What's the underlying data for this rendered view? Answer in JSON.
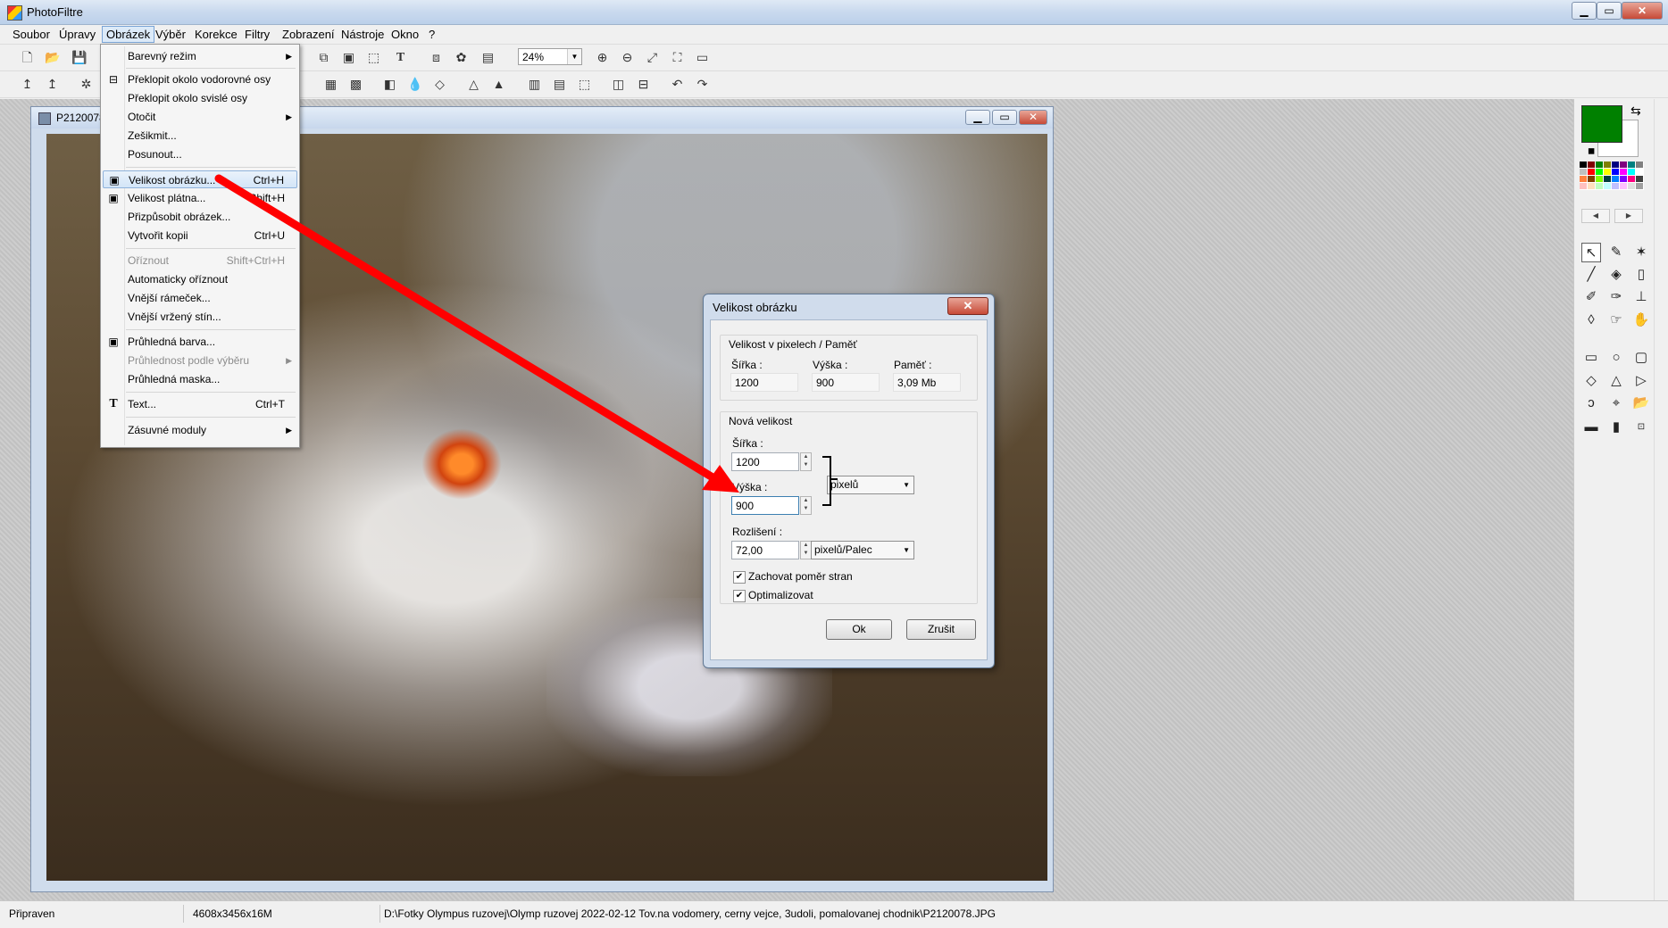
{
  "app": {
    "title": "PhotoFiltre"
  },
  "window_controls": {
    "minimize": "▁",
    "restore": "▭",
    "close": "✕"
  },
  "menubar": [
    "Soubor",
    "Úpravy",
    "Obrázek",
    "Výběr",
    "Korekce",
    "Filtry",
    "Zobrazení",
    "Nástroje",
    "Okno",
    "?"
  ],
  "toolbar": {
    "zoom": "24%"
  },
  "document": {
    "title": "P2120078"
  },
  "image_menu": {
    "items": [
      {
        "label": "Barevný režim",
        "shortcut": "",
        "submenu": true,
        "icon": "",
        "disabled": false
      },
      {
        "label": "Překlopit okolo vodorovné osy",
        "shortcut": "",
        "submenu": false,
        "icon": "flip-horizontal-icon",
        "disabled": false
      },
      {
        "label": "Překlopit okolo svislé osy",
        "shortcut": "",
        "submenu": false,
        "icon": "",
        "disabled": false
      },
      {
        "label": "Otočit",
        "shortcut": "",
        "submenu": true,
        "icon": "",
        "disabled": false
      },
      {
        "label": "Zešikmit...",
        "shortcut": "",
        "submenu": false,
        "icon": "",
        "disabled": false
      },
      {
        "label": "Posunout...",
        "shortcut": "",
        "submenu": false,
        "icon": "",
        "disabled": false
      },
      {
        "label": "Velikost obrázku...",
        "shortcut": "Ctrl+H",
        "submenu": false,
        "icon": "image-size-icon",
        "disabled": false
      },
      {
        "label": "Velikost plátna...",
        "shortcut": "Shift+H",
        "submenu": false,
        "icon": "canvas-size-icon",
        "disabled": false
      },
      {
        "label": "Přizpůsobit obrázek...",
        "shortcut": "",
        "submenu": false,
        "icon": "",
        "disabled": false
      },
      {
        "label": "Vytvořit kopii",
        "shortcut": "Ctrl+U",
        "submenu": false,
        "icon": "",
        "disabled": false
      },
      {
        "label": "Oříznout",
        "shortcut": "Shift+Ctrl+H",
        "submenu": false,
        "icon": "",
        "disabled": true
      },
      {
        "label": "Automaticky oříznout",
        "shortcut": "",
        "submenu": false,
        "icon": "",
        "disabled": false
      },
      {
        "label": "Vnější rámeček...",
        "shortcut": "",
        "submenu": false,
        "icon": "",
        "disabled": false
      },
      {
        "label": "Vnější vržený stín...",
        "shortcut": "",
        "submenu": false,
        "icon": "",
        "disabled": false
      },
      {
        "label": "Průhledná barva...",
        "shortcut": "",
        "submenu": false,
        "icon": "transparent-color-icon",
        "disabled": false
      },
      {
        "label": "Průhlednost podle výběru",
        "shortcut": "",
        "submenu": true,
        "icon": "",
        "disabled": true
      },
      {
        "label": "Průhledná maska...",
        "shortcut": "",
        "submenu": false,
        "icon": "",
        "disabled": false
      },
      {
        "label": "Text...",
        "shortcut": "Ctrl+T",
        "submenu": false,
        "icon": "text-icon",
        "disabled": false
      },
      {
        "label": "Zásuvné moduly",
        "shortcut": "",
        "submenu": true,
        "icon": "",
        "disabled": false
      }
    ]
  },
  "dialog": {
    "title": "Velikost obrázku",
    "close": "✕",
    "current_group": "Velikost v pixelech / Paměť",
    "width_label": "Šířka :",
    "height_label": "Výška :",
    "memory_label": "Paměť :",
    "cur_width": "1200",
    "cur_height": "900",
    "cur_memory": "3,09 Mb",
    "new_group": "Nová velikost",
    "new_width_label": "Šířka :",
    "new_width": "1200",
    "new_height_label": "Výška :",
    "new_height": "900",
    "unit": "pixelů",
    "resolution_label": "Rozlišení :",
    "resolution": "72,00",
    "resolution_unit": "pixelů/Palec",
    "keep_ratio": "Zachovat poměr stran",
    "optimize": "Optimalizovat",
    "ok": "Ok",
    "cancel": "Zrušit"
  },
  "colors": {
    "foreground": "#008000",
    "background": "#ffffff",
    "arrow": "#ff0000"
  },
  "statusbar": {
    "state": "Připraven",
    "dimensions": "4608x3456x16M",
    "path": "D:\\Fotky Olympus ruzovej\\Olymp ruzovej 2022-02-12 Tov.na vodomery, cerny vejce, 3udoli, pomalovanej chodnik\\P2120078.JPG"
  }
}
